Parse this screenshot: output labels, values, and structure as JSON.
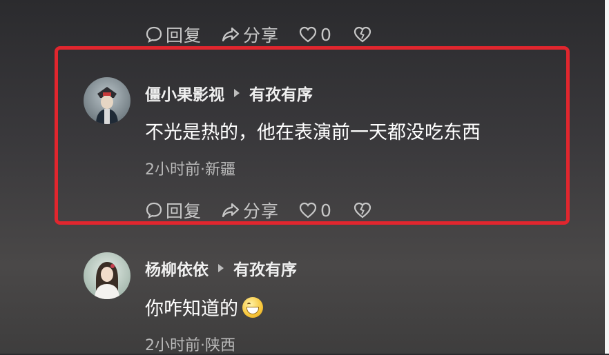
{
  "top_actions": {
    "reply": "回复",
    "share": "分享",
    "like_count": "0"
  },
  "comments": [
    {
      "user": "僵小果影视",
      "reply_to": "有孜有序",
      "text": "不光是热的，他在表演前一天都没吃东西",
      "meta": "2小时前·新疆",
      "actions": {
        "reply": "回复",
        "share": "分享",
        "like_count": "0"
      }
    },
    {
      "user": "杨柳依依",
      "reply_to": "有孜有序",
      "text": "你咋知道的",
      "emoji": "grinning-face-emoji",
      "meta": "2小时前·陕西"
    }
  ],
  "highlight_color": "#e1262e",
  "icons": [
    "comment-icon",
    "share-icon",
    "heart-icon",
    "dislike-heart-icon",
    "chevron-right-icon"
  ]
}
